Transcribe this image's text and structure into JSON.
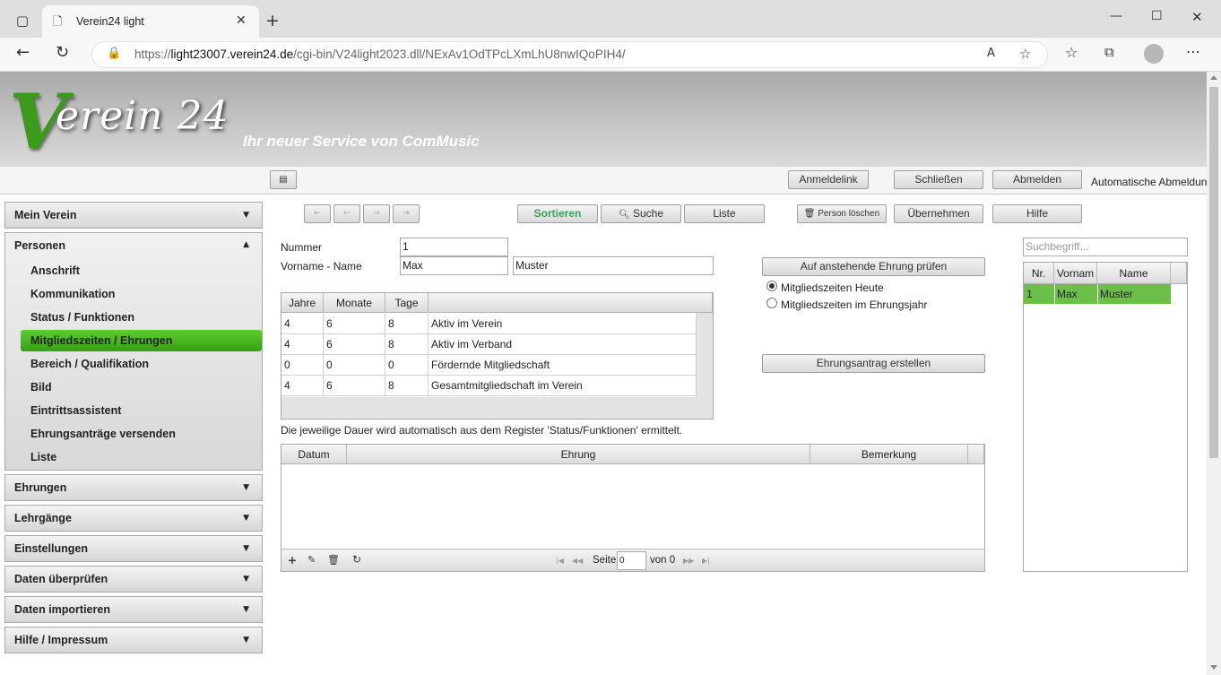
{
  "browser": {
    "tab_title": "Verein24 light",
    "url_prefix": "https://",
    "url_host": "light23007.verein24.de",
    "url_path": "/cgi-bin/V24light2023.dll/NExAv1OdTPcLXmLhU8nwIQoPIH4/"
  },
  "banner": {
    "logo_v": "V",
    "logo_rest": "erein 24",
    "slogan": "Ihr neuer Service von ComMusic"
  },
  "toolbar": {
    "anmeldelink": "Anmeldelink",
    "schliessen": "Schließen",
    "abmelden": "Abmelden",
    "auto_logout": "Automatische Abmeldung"
  },
  "sidebar": {
    "mein_verein": "Mein Verein",
    "personen": "Personen",
    "items": [
      "Anschrift",
      "Kommunikation",
      "Status / Funktionen",
      "Mitgliedszeiten / Ehrungen",
      "Bereich / Qualifikation",
      "Bild",
      "Eintrittsassistent",
      "Ehrungsanträge versenden",
      "Liste"
    ],
    "sections": [
      "Ehrungen",
      "Lehrgänge",
      "Einstellungen",
      "Daten überprüfen",
      "Daten importieren",
      "Hilfe / Impressum"
    ]
  },
  "actions": {
    "sortieren": "Sortieren",
    "suche": "Suche",
    "liste": "Liste",
    "person_loeschen": "Person löschen",
    "uebernehmen": "Übernehmen",
    "hilfe": "Hilfe"
  },
  "form": {
    "nummer_label": "Nummer",
    "nummer": "1",
    "name_label": "Vorname - Name",
    "vorname": "Max",
    "nachname": "Muster"
  },
  "duration_table": {
    "headers": [
      "Jahre",
      "Monate",
      "Tage"
    ],
    "rows": [
      [
        "4",
        "6",
        "8",
        "Aktiv im Verein"
      ],
      [
        "4",
        "6",
        "8",
        "Aktiv im Verband"
      ],
      [
        "0",
        "0",
        "0",
        "Fördernde Mitgliedschaft"
      ],
      [
        "4",
        "6",
        "8",
        "Gesamtmitgliedschaft im Verein"
      ]
    ],
    "note": "Die jeweilige Dauer wird automatisch aus dem Register 'Status/Funktionen' ermittelt."
  },
  "honors": {
    "check_button": "Auf anstehende Ehrung prüfen",
    "radio_today": "Mitgliedszeiten Heute",
    "radio_year": "Mitgliedszeiten im Ehrungsjahr",
    "create_button": "Ehrungsantrag erstellen"
  },
  "honor_grid": {
    "headers": [
      "Datum",
      "Ehrung",
      "Bemerkung"
    ],
    "page_label": "Seite",
    "page_value": "0",
    "of_label": "von 0"
  },
  "search": {
    "placeholder": "Suchbegriff...",
    "headers": [
      "Nr.",
      "Vornam",
      "Name"
    ],
    "rows": [
      [
        "1",
        "Max",
        "Muster"
      ]
    ]
  },
  "colors": {
    "accent_green": "#3fa81a",
    "selected_row": "#6cc04a"
  }
}
